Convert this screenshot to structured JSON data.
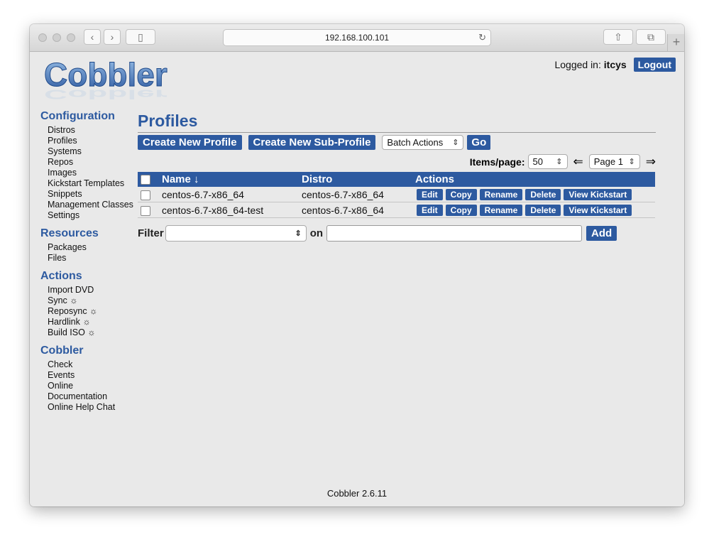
{
  "browser": {
    "url": "192.168.100.101"
  },
  "header": {
    "logged_in_label": "Logged in:",
    "username": "itcys",
    "logout_label": "Logout",
    "logo_text": "Cobbler"
  },
  "sidebar": {
    "sections": [
      {
        "title": "Configuration",
        "items": [
          "Distros",
          "Profiles",
          "Systems",
          "Repos",
          "Images",
          "Kickstart Templates",
          "Snippets",
          "Management Classes",
          "Settings"
        ]
      },
      {
        "title": "Resources",
        "items": [
          "Packages",
          "Files"
        ]
      },
      {
        "title": "Actions",
        "items": [
          "Import DVD",
          "Sync ☼",
          "Reposync ☼",
          "Hardlink ☼",
          "Build ISO ☼"
        ]
      },
      {
        "title": "Cobbler",
        "items": [
          "Check",
          "Events",
          "Online",
          "Documentation",
          "Online Help Chat"
        ]
      }
    ]
  },
  "main": {
    "title": "Profiles",
    "create_profile_label": "Create New Profile",
    "create_subprofile_label": "Create New Sub-Profile",
    "batch_actions_label": "Batch Actions",
    "go_label": "Go",
    "items_per_page_label": "Items/page:",
    "items_per_page_value": "50",
    "prev_arrow": "⇐",
    "page_value": "Page 1",
    "next_arrow": "⇒",
    "table": {
      "columns": [
        "Name ↓",
        "Distro",
        "Actions"
      ],
      "rows": [
        {
          "name": "centos-6.7-x86_64",
          "distro": "centos-6.7-x86_64"
        },
        {
          "name": "centos-6.7-x86_64-test",
          "distro": "centos-6.7-x86_64"
        }
      ],
      "action_labels": [
        "Edit",
        "Copy",
        "Rename",
        "Delete",
        "View Kickstart"
      ]
    },
    "filter_label": "Filter",
    "on_label": "on",
    "add_label": "Add"
  },
  "footer": {
    "version": "Cobbler 2.6.11"
  },
  "colors": {
    "accent": "#2d5aa0",
    "page_bg": "#e9e9e9"
  }
}
